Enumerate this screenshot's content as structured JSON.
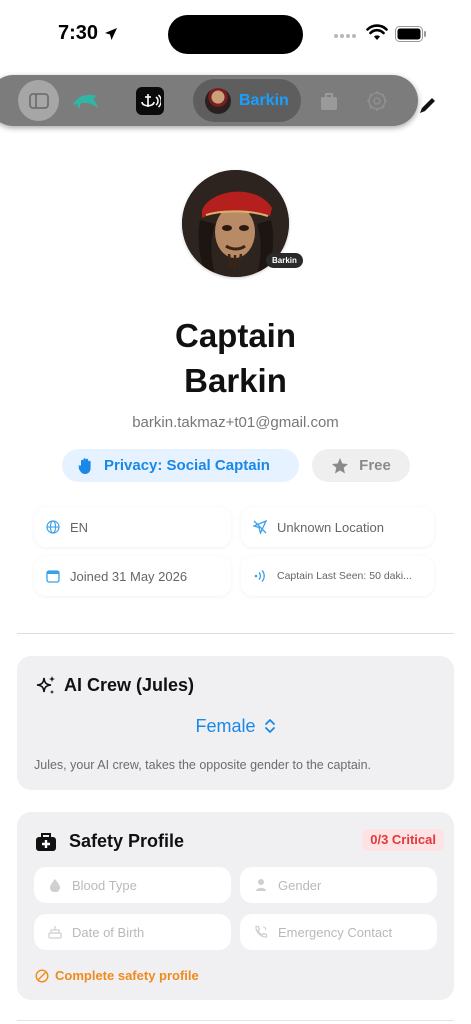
{
  "status_bar": {
    "time": "7:30"
  },
  "toolbar": {
    "active_tab_label": "Barkin"
  },
  "profile": {
    "avatar_badge": "Barkin",
    "name_line1": "Captain",
    "name_line2": "Barkin",
    "email": "barkin.takmaz+t01@gmail.com",
    "privacy_chip": "Privacy: Social Captain",
    "plan_chip": "Free",
    "info": {
      "language": "EN",
      "location": "Unknown Location",
      "joined": "Joined 31 May 2026",
      "last_seen": "Captain Last Seen: 50 daki..."
    }
  },
  "ai_crew": {
    "title": "AI Crew (Jules)",
    "gender_value": "Female",
    "description": "Jules, your AI crew, takes the opposite gender to the captain."
  },
  "safety_profile": {
    "title": "Safety Profile",
    "critical_badge": "0/3 Critical",
    "fields": {
      "blood_type": "Blood Type",
      "gender": "Gender",
      "date_of_birth": "Date of Birth",
      "emergency_contact": "Emergency Contact"
    },
    "complete_link": "Complete safety profile"
  },
  "colors": {
    "accent_blue": "#1a88e6",
    "critical_red": "#e03a3a",
    "warning_orange": "#f08a1c"
  }
}
